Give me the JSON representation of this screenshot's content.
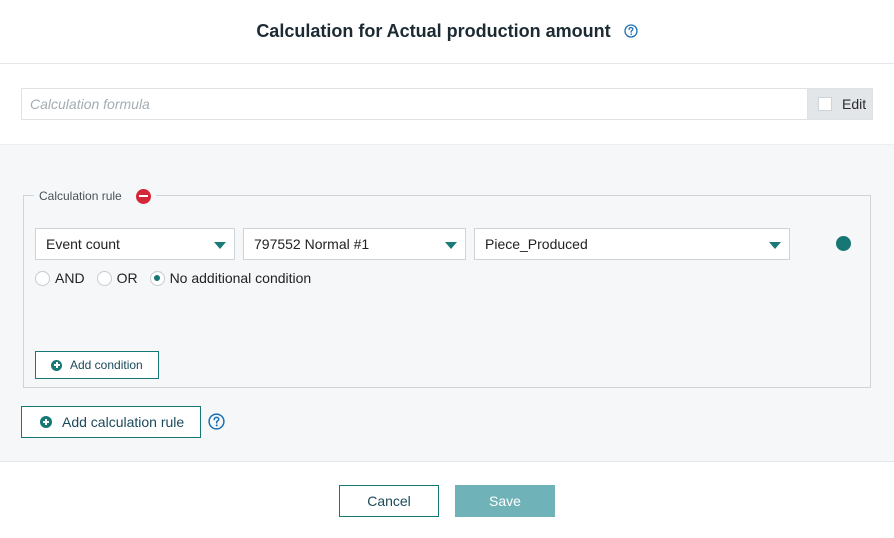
{
  "dialog": {
    "title": "Calculation for Actual production amount"
  },
  "formula": {
    "placeholder": "Calculation formula",
    "value": "",
    "edit_label": "Edit",
    "edit_checked": false
  },
  "rule": {
    "legend": "Calculation rule",
    "selects": [
      {
        "value": "Event count"
      },
      {
        "value": "797552 Normal #1"
      },
      {
        "value": "Piece_Produced"
      }
    ],
    "conditions": [
      {
        "label": "AND",
        "checked": false
      },
      {
        "label": "OR",
        "checked": false
      },
      {
        "label": "No additional condition",
        "checked": true
      }
    ],
    "add_condition_label": "Add condition"
  },
  "add_rule_label": "Add calculation rule",
  "footer": {
    "cancel_label": "Cancel",
    "save_label": "Save"
  },
  "colors": {
    "accent": "#167774",
    "remove": "#d3283a",
    "save_button": "#6fb3b8",
    "panel_bg": "#f6f7f8",
    "help_icon": "#1a6fb5"
  }
}
